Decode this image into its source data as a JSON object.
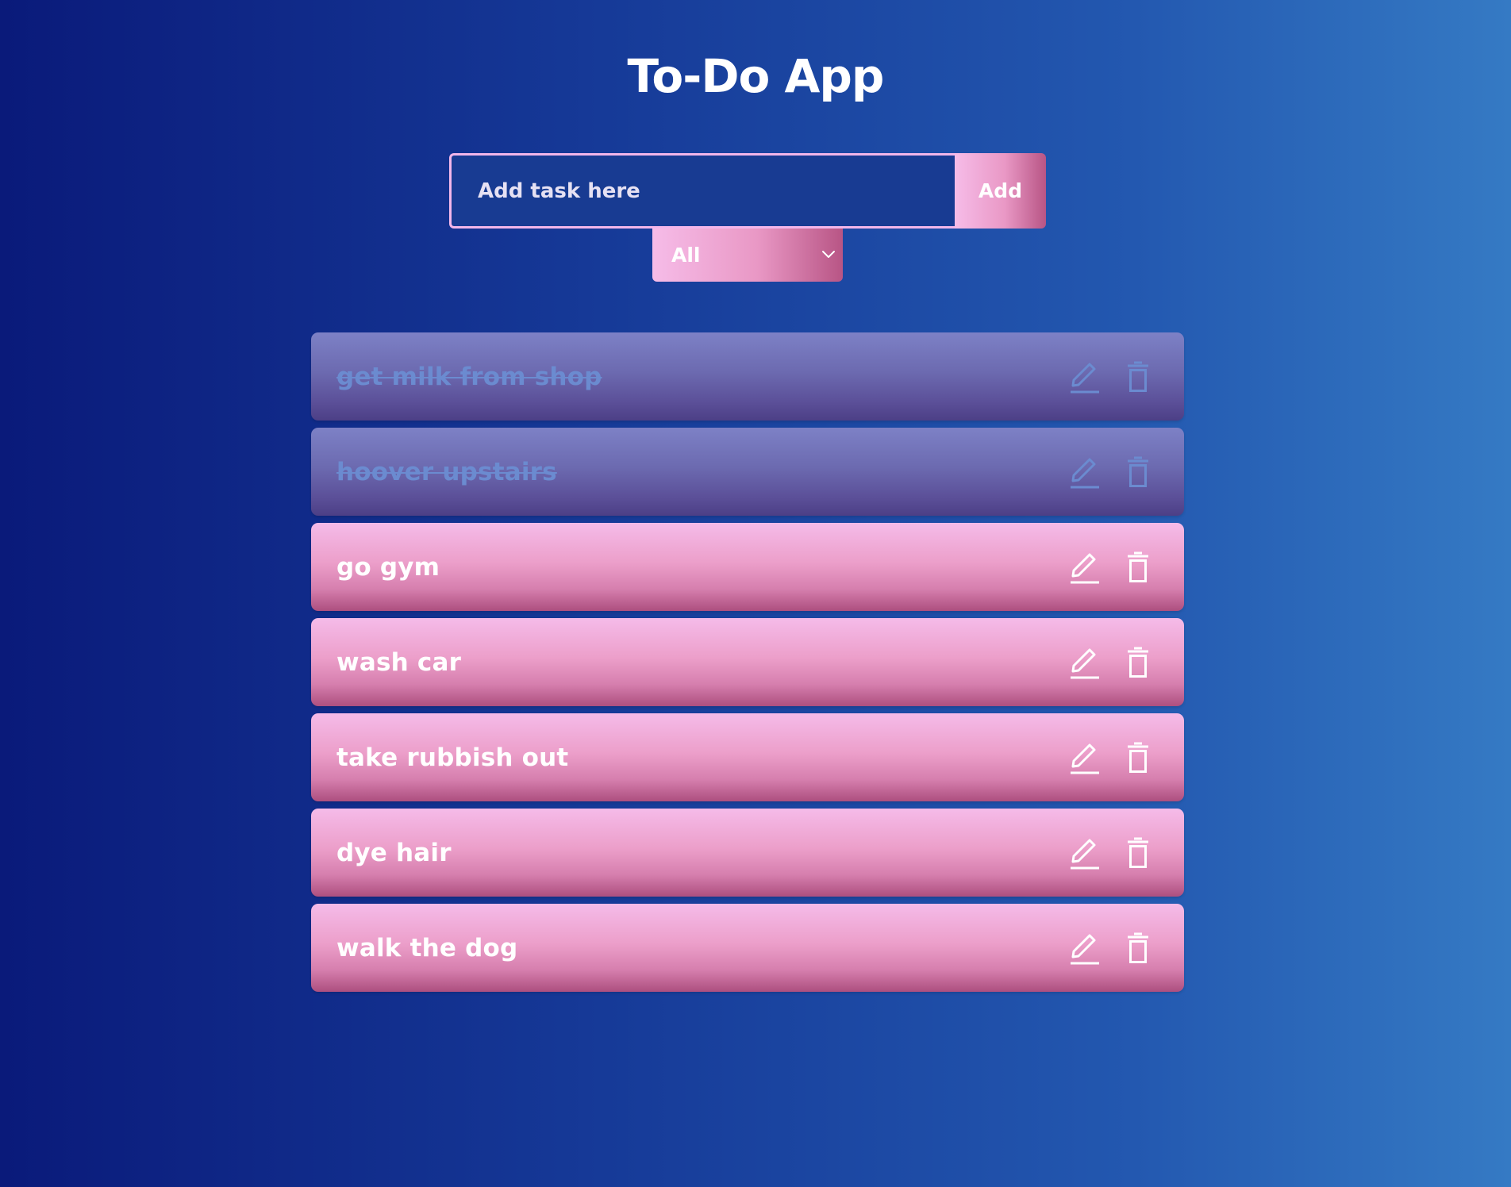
{
  "app": {
    "title": "To-Do App"
  },
  "form": {
    "input_placeholder": "Add task here",
    "input_value": "",
    "add_label": "Add"
  },
  "filter": {
    "selected": "All"
  },
  "icons": {
    "edit": "pencil-icon",
    "delete": "trash-icon",
    "filter_dropdown": "chevron-down-icon"
  },
  "colors": {
    "background_start": "#0a1a7a",
    "background_end": "#357ac4",
    "accent_pink": "#f2b6ea",
    "completed_text": "#6b8bd0"
  },
  "todos": [
    {
      "text": "get milk from shop",
      "completed": true
    },
    {
      "text": "hoover upstairs",
      "completed": true
    },
    {
      "text": "go gym",
      "completed": false
    },
    {
      "text": "wash car",
      "completed": false
    },
    {
      "text": "take rubbish out",
      "completed": false
    },
    {
      "text": "dye hair",
      "completed": false
    },
    {
      "text": "walk the dog",
      "completed": false
    }
  ]
}
